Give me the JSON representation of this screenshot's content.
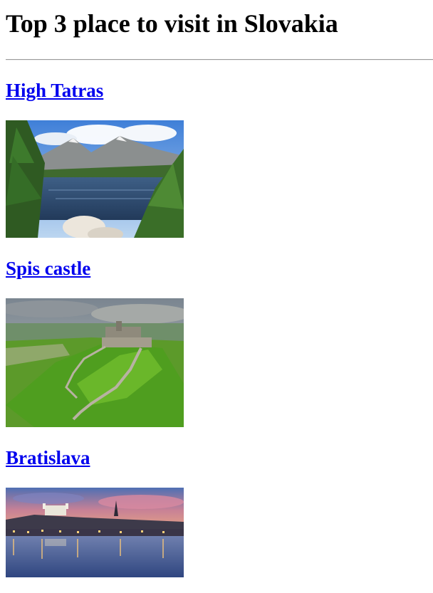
{
  "page": {
    "title": "Top 3 place to visit in Slovakia"
  },
  "places": [
    {
      "name": "High Tatras",
      "image_alt": "High Tatras mountains and lake"
    },
    {
      "name": "Spis castle",
      "image_alt": "Spis castle on a green hill"
    },
    {
      "name": "Bratislava",
      "image_alt": "Bratislava skyline at dusk"
    }
  ],
  "colors": {
    "link": "#0000ee"
  }
}
